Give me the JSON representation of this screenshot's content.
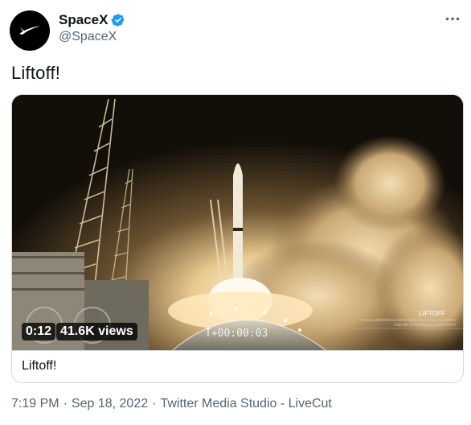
{
  "author": {
    "display_name": "SpaceX",
    "handle": "@SpaceX",
    "verified_icon": "verified-badge-icon",
    "avatar_icon": "spacex-logo-icon"
  },
  "menu_icon": "more-options-icon",
  "tweet_text": "Liftoff!",
  "media": {
    "duration": "0:12",
    "views": "41.6K views",
    "countdown": "T+00:00:03",
    "overlay_title": "LIFTOFF",
    "overlay_subtitle": "THE HOLDDOWN CLAMPS HAVE RELEASED FALCON 9 AND WE HAVE BEGUN OUR FLIGHT",
    "caption": "Liftoff!"
  },
  "footer": {
    "time": "7:19 PM",
    "sep1": "·",
    "date": "Sep 18, 2022",
    "sep2": "·",
    "source": "Twitter Media Studio - LiveCut"
  },
  "colors": {
    "text_primary": "#0f1419",
    "text_secondary": "#536471",
    "verified_blue": "#1d9bf0",
    "border": "#cfd9de"
  }
}
